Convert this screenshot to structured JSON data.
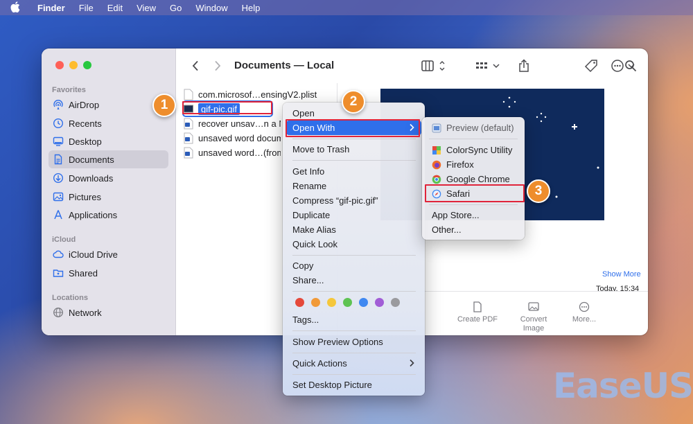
{
  "menubar": {
    "items": [
      "Finder",
      "File",
      "Edit",
      "View",
      "Go",
      "Window",
      "Help"
    ]
  },
  "window": {
    "title": "Documents — Local"
  },
  "sidebar": {
    "sections": [
      {
        "label": "Favorites",
        "items": [
          "AirDrop",
          "Recents",
          "Desktop",
          "Documents",
          "Downloads",
          "Pictures",
          "Applications"
        ]
      },
      {
        "label": "iCloud",
        "items": [
          "iCloud Drive",
          "Shared"
        ]
      },
      {
        "label": "Locations",
        "items": [
          "Network"
        ]
      }
    ],
    "active": "Documents"
  },
  "files": [
    "com.microsof…ensingV2.plist",
    "gif-pic.gif",
    "recover unsav…n a M",
    "unsaved word docum",
    "unsaved word…(from"
  ],
  "selected_file": "gif-pic.gif",
  "preview": {
    "show_more": "Show More",
    "date": "Today, 15:34",
    "quick_actions": [
      "Create PDF",
      "Convert Image",
      "More..."
    ]
  },
  "context_menu": {
    "items": [
      "Open",
      "Open With",
      "Move to Trash",
      "Get Info",
      "Rename",
      "Compress “gif-pic.gif”",
      "Duplicate",
      "Make Alias",
      "Quick Look",
      "Copy",
      "Share...",
      "Tags...",
      "Show Preview Options",
      "Quick Actions",
      "Set Desktop Picture"
    ],
    "highlighted": "Open With",
    "tag_colors": [
      "#e5493a",
      "#f19a38",
      "#f5c73b",
      "#5ec352",
      "#3f88f1",
      "#a15dd6",
      "#9a9a9e"
    ]
  },
  "open_with_menu": {
    "items": [
      "Preview (default)",
      "ColorSync Utility",
      "Firefox",
      "Google Chrome",
      "Safari",
      "App Store...",
      "Other..."
    ]
  },
  "step_badges": [
    "1",
    "2",
    "3"
  ],
  "highlight_color": "#e0243a",
  "badge_color": "#ee8d2c",
  "watermark": "EaseUS"
}
